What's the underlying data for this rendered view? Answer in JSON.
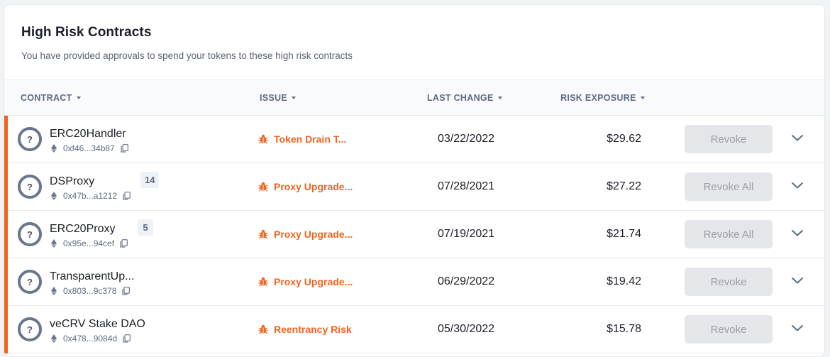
{
  "header": {
    "title": "High Risk Contracts",
    "subtitle": "You have provided approvals to spend your tokens to these high risk contracts"
  },
  "columns": {
    "contract": "CONTRACT",
    "issue": "ISSUE",
    "last_change": "LAST CHANGE",
    "risk_exposure": "RISK EXPOSURE"
  },
  "colors": {
    "accent": "#f0641e",
    "muted": "#5d6b82"
  },
  "rows": [
    {
      "name": "ERC20Handler",
      "address": "0xf46...34b87",
      "count": "",
      "issue": "Token Drain T...",
      "last_change": "03/22/2022",
      "exposure": "$29.62",
      "action": "Revoke"
    },
    {
      "name": "DSProxy",
      "address": "0x47b...a1212",
      "count": "14",
      "issue": "Proxy Upgrade...",
      "last_change": "07/28/2021",
      "exposure": "$27.22",
      "action": "Revoke All"
    },
    {
      "name": "ERC20Proxy",
      "address": "0x95e...94cef",
      "count": "5",
      "issue": "Proxy Upgrade...",
      "last_change": "07/19/2021",
      "exposure": "$21.74",
      "action": "Revoke All"
    },
    {
      "name": "TransparentUp...",
      "address": "0x803...9c378",
      "count": "",
      "issue": "Proxy Upgrade...",
      "last_change": "06/29/2022",
      "exposure": "$19.42",
      "action": "Revoke"
    },
    {
      "name": "veCRV Stake DAO",
      "address": "0x478...9084d",
      "count": "",
      "issue": "Reentrancy Risk",
      "last_change": "05/30/2022",
      "exposure": "$15.78",
      "action": "Revoke"
    }
  ]
}
